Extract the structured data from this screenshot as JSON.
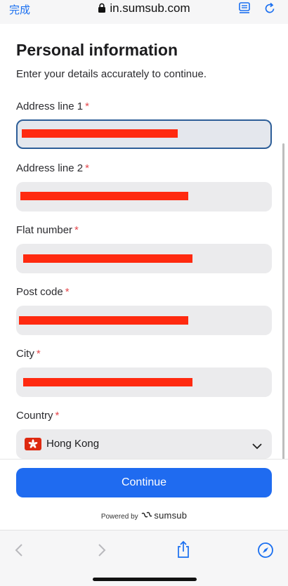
{
  "browser": {
    "done_label": "完成",
    "url": "in.sumsub.com",
    "icons": [
      "lock-icon",
      "reader-icon",
      "reload-icon"
    ]
  },
  "form": {
    "title": "Personal information",
    "subtitle": "Enter your details accurately to continue.",
    "required_marker": "*",
    "fields": [
      {
        "label": "Address line 1",
        "value": "",
        "state": "focused",
        "redacted": true
      },
      {
        "label": "Address line 2",
        "value": "",
        "state": "default",
        "redacted": true
      },
      {
        "label": "Flat number",
        "value": "",
        "state": "default",
        "redacted": true
      },
      {
        "label": "Post code",
        "value": "",
        "state": "default",
        "redacted": true
      },
      {
        "label": "City",
        "value": "",
        "state": "default",
        "redacted": true
      }
    ],
    "country": {
      "label": "Country",
      "value": "Hong Kong",
      "flag": "hong-kong-flag-icon"
    }
  },
  "footer": {
    "continue_label": "Continue",
    "powered_by": "Powered by",
    "brand": "sumsub"
  },
  "colors": {
    "accent": "#1f6bf0",
    "required": "#e5484d",
    "redaction": "#ff2a10",
    "focus_border": "#2d5e98"
  }
}
